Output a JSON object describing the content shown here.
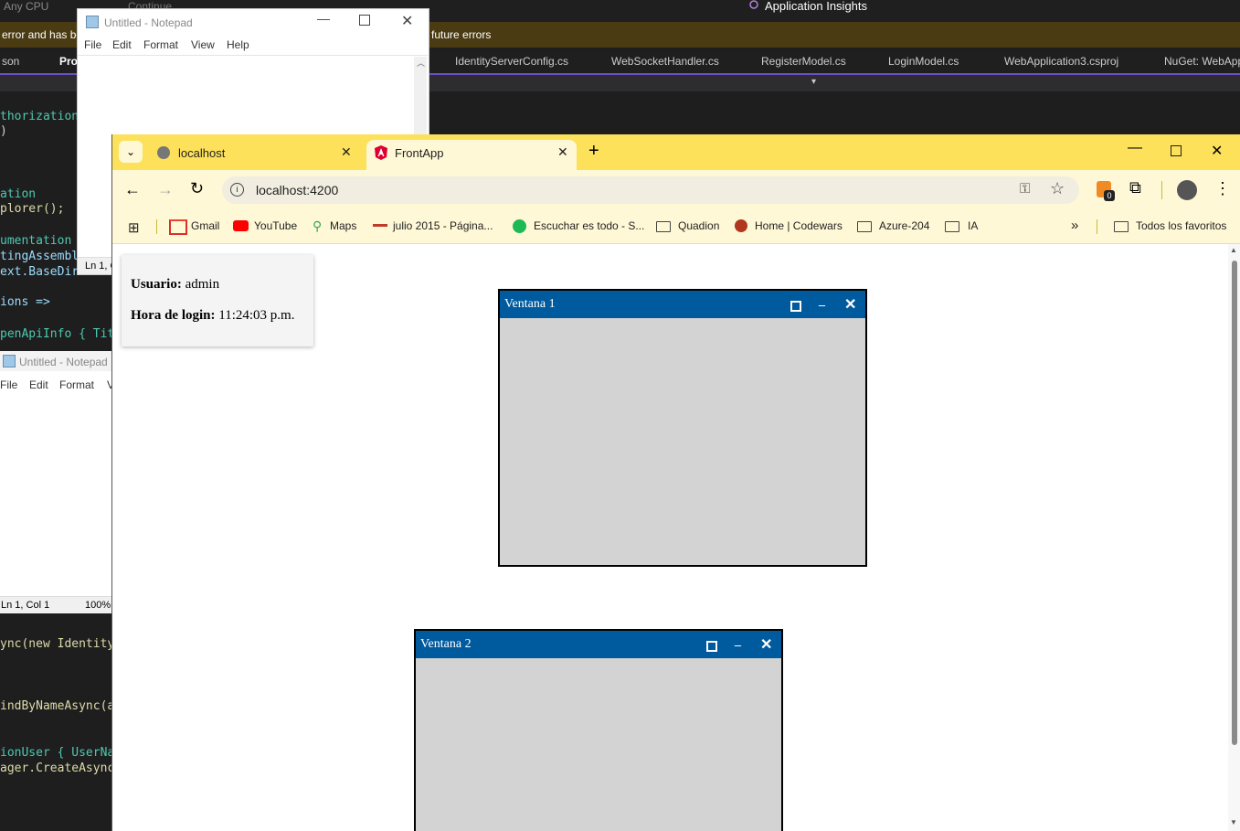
{
  "vs": {
    "config_label": "Any CPU",
    "continue_label": "Continue",
    "app_insights_label": "Application Insights",
    "infobar_left": "error and has be",
    "infobar_right": "future errors",
    "tabs": [
      "son",
      "Pro",
      "IdentityServerConfig.cs",
      "WebSocketHandler.cs",
      "RegisterModel.cs",
      "LoginModel.cs",
      "WebApplication3.csproj",
      "NuGet: WebApp"
    ],
    "code_lines": [
      {
        "text": "thorization",
        "color": "#4ec9b0"
      },
      {
        "text": ")",
        "color": "#d4d4d4"
      },
      {
        "text": "ation",
        "color": "#4ec9b0"
      },
      {
        "text": "plorer();",
        "color": "#dcdcaa"
      },
      {
        "text": "umentation",
        "color": "#4ec9b0"
      },
      {
        "text": "tingAssembl",
        "color": "#9cdcfe"
      },
      {
        "text": "ext.BaseDire",
        "color": "#9cdcfe"
      },
      {
        "text": "ions =>",
        "color": "#9cdcfe"
      },
      {
        "text": "penApiInfo { Tit",
        "color": "#4ec9b0"
      },
      {
        "text": "ync(new Identity",
        "color": "#dcdcaa"
      },
      {
        "text": "indByNameAsync(a",
        "color": "#dcdcaa"
      },
      {
        "text": "ionUser { UserNa",
        "color": "#4ec9b0"
      },
      {
        "text": "ager.CreateAsync",
        "color": "#dcdcaa"
      }
    ],
    "status_left": "Ln 1, Col 1",
    "status_zoom": "100%"
  },
  "notepad_top": {
    "title": "Untitled - Notepad",
    "menu": [
      "File",
      "Edit",
      "Format",
      "View",
      "Help"
    ],
    "status": "Ln 1, C"
  },
  "notepad_bottom": {
    "title": "Untitled - Notepad",
    "menu": [
      "File",
      "Edit",
      "Format",
      "V"
    ]
  },
  "chrome": {
    "tabs": [
      {
        "title": "localhost",
        "active": false
      },
      {
        "title": "FrontApp",
        "active": true
      }
    ],
    "url": "localhost:4200",
    "extension_badge": "0",
    "bookmarks": [
      {
        "label": "Gmail",
        "icon": "gmail-icon"
      },
      {
        "label": "YouTube",
        "icon": "youtube-icon"
      },
      {
        "label": "Maps",
        "icon": "maps-icon"
      },
      {
        "label": "julio 2015 - Página...",
        "icon": "site-icon"
      },
      {
        "label": "Escuchar es todo - S...",
        "icon": "spotify-icon"
      },
      {
        "label": "Quadion",
        "icon": "folder-icon"
      },
      {
        "label": "Home | Codewars",
        "icon": "codewars-icon"
      },
      {
        "label": "Azure-204",
        "icon": "folder-icon"
      },
      {
        "label": "IA",
        "icon": "folder-icon"
      }
    ],
    "all_bookmarks_label": "Todos los favoritos",
    "colors": {
      "tabstrip": "#fde15a",
      "toolbar": "#fff8d6",
      "window_title": "#005a9e"
    }
  },
  "app": {
    "user_label": "Usuario:",
    "user_value": "admin",
    "login_label": "Hora de login:",
    "login_value": "11:24:03 p.m.",
    "windows": [
      {
        "title": "Ventana 1"
      },
      {
        "title": "Ventana 2"
      }
    ]
  }
}
